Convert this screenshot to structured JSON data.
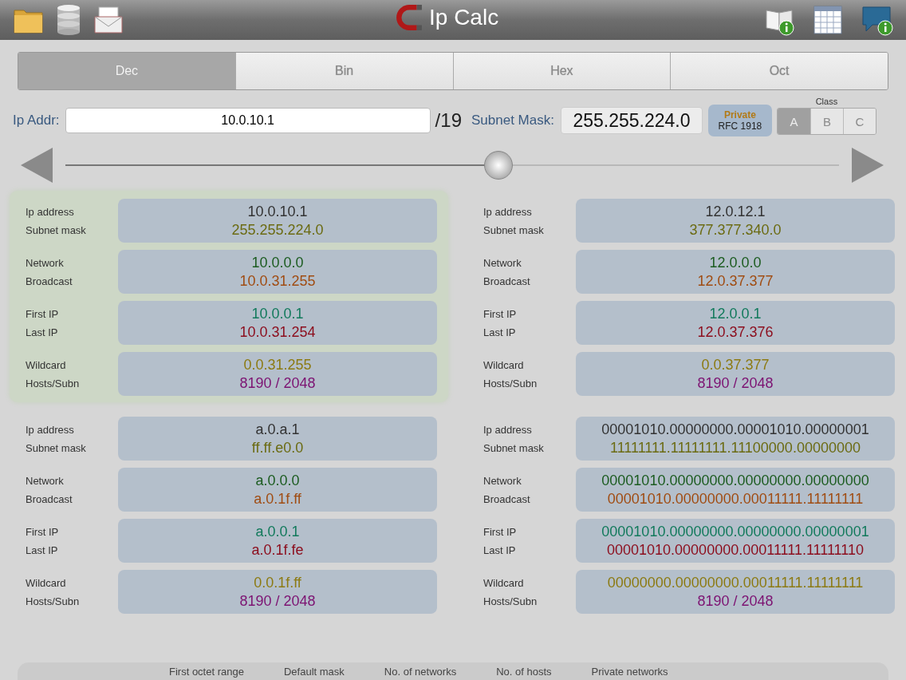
{
  "toolbar": {
    "title": "Ip Calc"
  },
  "tabs": [
    {
      "label": "Dec",
      "selected": true
    },
    {
      "label": "Bin",
      "selected": false
    },
    {
      "label": "Hex",
      "selected": false
    },
    {
      "label": "Oct",
      "selected": false
    }
  ],
  "ip_field": {
    "label": "Ip Addr:",
    "value": "10.0.10.1"
  },
  "prefix": "/19",
  "subnet_mask": {
    "label": "Subnet Mask:",
    "value": "255.255.224.0"
  },
  "private_badge": {
    "title": "Private",
    "subtitle": "RFC 1918"
  },
  "class_selector": {
    "label": "Class",
    "options": [
      {
        "label": "A",
        "selected": true
      },
      {
        "label": "B",
        "selected": false
      },
      {
        "label": "C",
        "selected": false
      }
    ]
  },
  "slider": {
    "level": 0.56
  },
  "panels": [
    {
      "selected": true,
      "groups": [
        {
          "lines": [
            {
              "label": "Ip address",
              "value": "10.0.10.1",
              "color": "#333333"
            },
            {
              "label": "Subnet mask",
              "value": "255.255.224.0",
              "color": "#6b6b12"
            }
          ]
        },
        {
          "lines": [
            {
              "label": "Network",
              "value": "10.0.0.0",
              "color": "#1c5c20"
            },
            {
              "label": "Broadcast",
              "value": "10.0.31.255",
              "color": "#a04c12"
            }
          ]
        },
        {
          "lines": [
            {
              "label": "First IP",
              "value": "10.0.0.1",
              "color": "#127a5c"
            },
            {
              "label": "Last IP",
              "value": "10.0.31.254",
              "color": "#8c0c1c"
            }
          ]
        },
        {
          "lines": [
            {
              "label": "Wildcard",
              "value": "0.0.31.255",
              "color": "#8c7a12"
            },
            {
              "label": "Hosts/Subn",
              "value": "8190 / 2048",
              "color": "#7c1272"
            }
          ]
        }
      ]
    },
    {
      "selected": false,
      "groups": [
        {
          "lines": [
            {
              "label": "Ip address",
              "value": "12.0.12.1",
              "color": "#333333"
            },
            {
              "label": "Subnet mask",
              "value": "377.377.340.0",
              "color": "#6b6b12"
            }
          ]
        },
        {
          "lines": [
            {
              "label": "Network",
              "value": "12.0.0.0",
              "color": "#1c5c20"
            },
            {
              "label": "Broadcast",
              "value": "12.0.37.377",
              "color": "#a04c12"
            }
          ]
        },
        {
          "lines": [
            {
              "label": "First IP",
              "value": "12.0.0.1",
              "color": "#127a5c"
            },
            {
              "label": "Last IP",
              "value": "12.0.37.376",
              "color": "#8c0c1c"
            }
          ]
        },
        {
          "lines": [
            {
              "label": "Wildcard",
              "value": "0.0.37.377",
              "color": "#8c7a12"
            },
            {
              "label": "Hosts/Subn",
              "value": "8190 / 2048",
              "color": "#7c1272"
            }
          ]
        }
      ]
    },
    {
      "selected": false,
      "groups": [
        {
          "lines": [
            {
              "label": "Ip address",
              "value": "a.0.a.1",
              "color": "#333333"
            },
            {
              "label": "Subnet mask",
              "value": "ff.ff.e0.0",
              "color": "#6b6b12"
            }
          ]
        },
        {
          "lines": [
            {
              "label": "Network",
              "value": "a.0.0.0",
              "color": "#1c5c20"
            },
            {
              "label": "Broadcast",
              "value": "a.0.1f.ff",
              "color": "#a04c12"
            }
          ]
        },
        {
          "lines": [
            {
              "label": "First IP",
              "value": "a.0.0.1",
              "color": "#127a5c"
            },
            {
              "label": "Last IP",
              "value": "a.0.1f.fe",
              "color": "#8c0c1c"
            }
          ]
        },
        {
          "lines": [
            {
              "label": "Wildcard",
              "value": "0.0.1f.ff",
              "color": "#8c7a12"
            },
            {
              "label": "Hosts/Subn",
              "value": "8190 / 2048",
              "color": "#7c1272"
            }
          ]
        }
      ]
    },
    {
      "selected": false,
      "groups": [
        {
          "lines": [
            {
              "label": "Ip address",
              "value": "00001010.00000000.00001010.00000001",
              "color": "#333333"
            },
            {
              "label": "Subnet mask",
              "value": "11111111.11111111.11100000.00000000",
              "color": "#6b6b12"
            }
          ]
        },
        {
          "lines": [
            {
              "label": "Network",
              "value": "00001010.00000000.00000000.00000000",
              "color": "#1c5c20"
            },
            {
              "label": "Broadcast",
              "value": "00001010.00000000.00011111.11111111",
              "color": "#a04c12"
            }
          ]
        },
        {
          "lines": [
            {
              "label": "First IP",
              "value": "00001010.00000000.00000000.00000001",
              "color": "#127a5c"
            },
            {
              "label": "Last IP",
              "value": "00001010.00000000.00011111.11111110",
              "color": "#8c0c1c"
            }
          ]
        },
        {
          "lines": [
            {
              "label": "Wildcard",
              "value": "00000000.00000000.00011111.11111111",
              "color": "#8c7a12"
            },
            {
              "label": "Hosts/Subn",
              "value": "8190 / 2048",
              "color": "#7c1272"
            }
          ]
        }
      ]
    }
  ],
  "class_table": {
    "columns": [
      "First octet range",
      "Default mask",
      "No. of networks",
      "No. of hosts",
      "Private networks"
    ]
  }
}
